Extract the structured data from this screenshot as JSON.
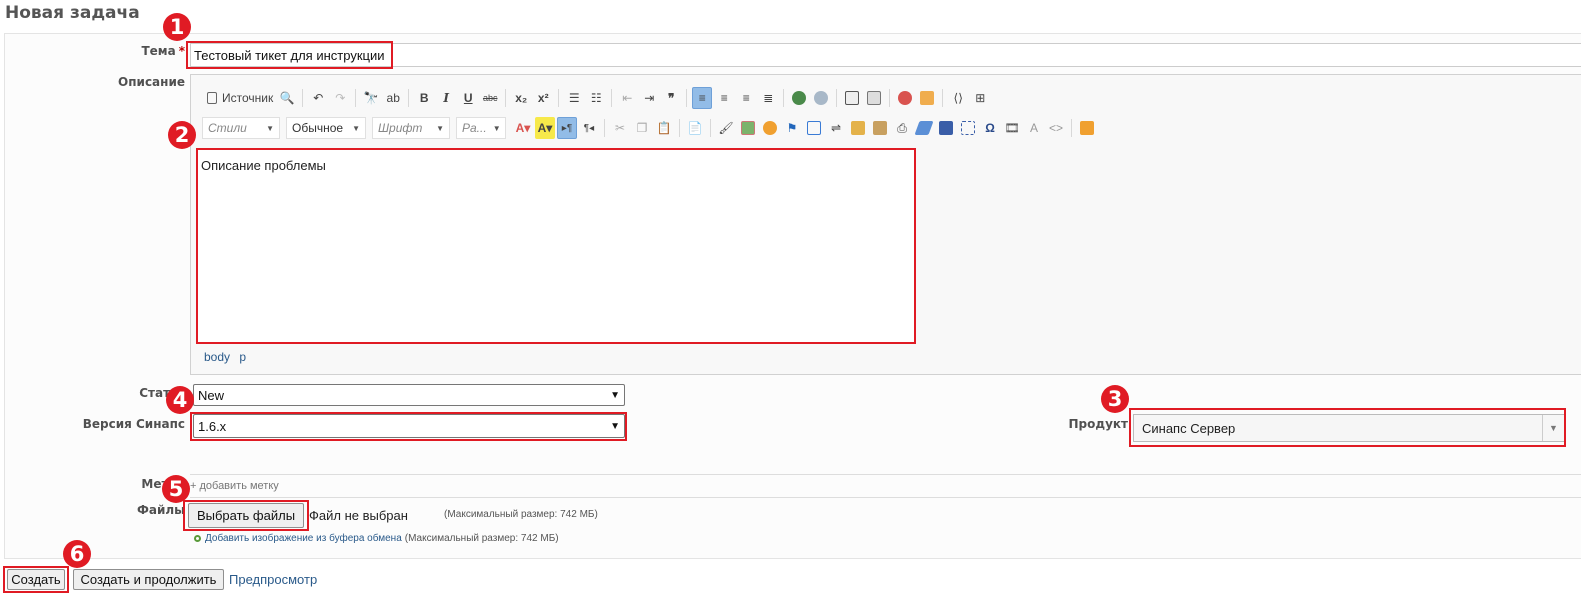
{
  "page_title": "Новая задача",
  "subject": {
    "label": "Тема",
    "required_mark": "*",
    "value": "Тестовый тикет для инструкции"
  },
  "description": {
    "label": "Описание",
    "toolbar_row1": {
      "source_label": "Источник"
    },
    "toolbar_row2": {
      "styles": "Стили",
      "format": "Обычное",
      "font": "Шрифт",
      "size": "Ра..."
    },
    "content": "Описание проблемы",
    "path": [
      "body",
      "p"
    ]
  },
  "status": {
    "label": "Статус",
    "value": "New"
  },
  "synapse_version": {
    "label": "Версия Синапс",
    "value": "1.6.x"
  },
  "product": {
    "label": "Продукт",
    "value": "Синапс Сервер"
  },
  "tags": {
    "label": "Метки",
    "add_label": "+ добавить метку"
  },
  "files": {
    "label": "Файлы",
    "choose_button": "Выбрать файлы",
    "no_file_text": "Файл не выбран",
    "max_size": "(Максимальный размер: 742 МБ)",
    "clipboard_link": "Добавить изображение из буфера обмена",
    "clipboard_max_size": "(Максимальный размер: 742 МБ)"
  },
  "actions": {
    "create": "Создать",
    "create_continue": "Создать и продолжить",
    "preview": "Предпросмотр"
  },
  "annotations": [
    "1",
    "2",
    "3",
    "4",
    "5",
    "6"
  ],
  "colors": {
    "annotation_red": "#e01b24",
    "link_blue": "#2a5a8a"
  }
}
